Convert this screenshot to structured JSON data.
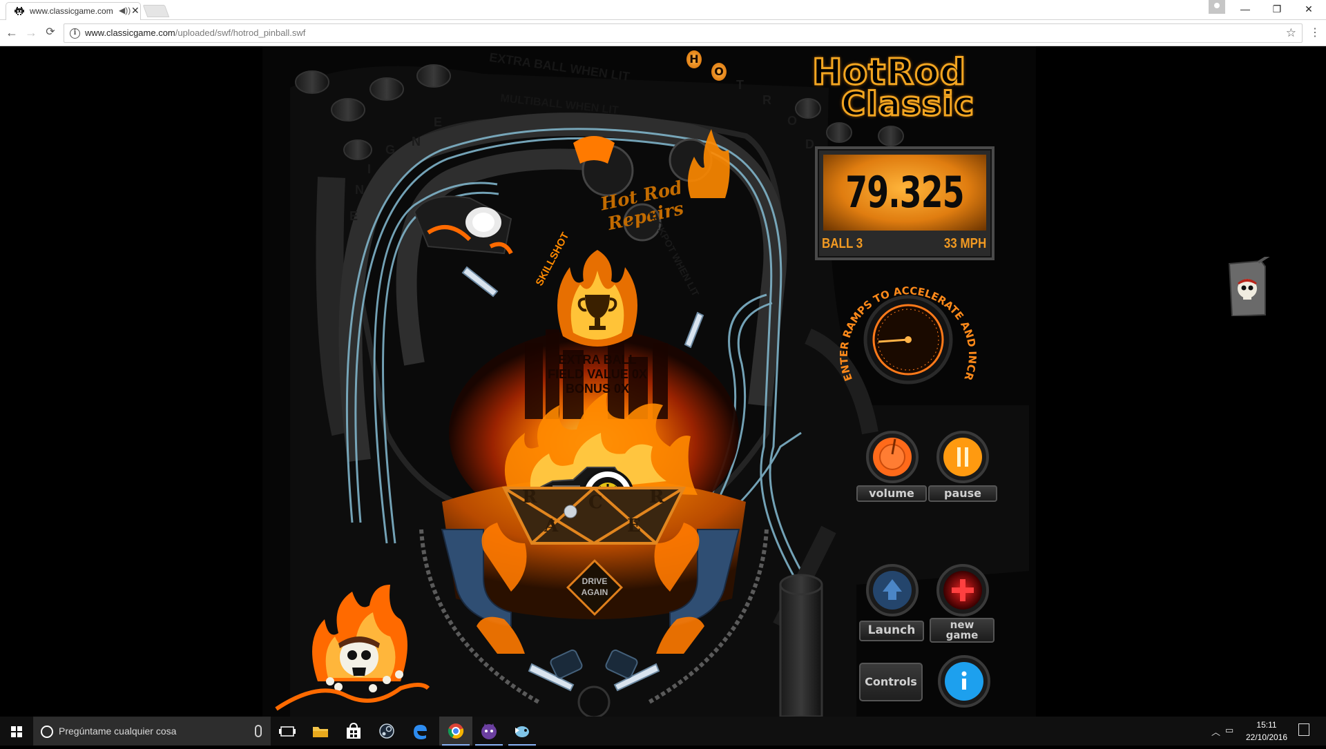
{
  "browser": {
    "tab_title": "www.classicgame.com",
    "tab_audio_icon": "speaker-icon",
    "tab_close": "✕",
    "url_host": "www.classicgame.com",
    "url_path": "/uploaded/swf/hotrod_pinball.swf",
    "window_controls": {
      "minimize": "—",
      "restore": "❐",
      "close": "✕"
    }
  },
  "game": {
    "logo_line1": "HotRod",
    "logo_line2": "Classic",
    "score": "79.325",
    "ball": "BALL 3",
    "speed": "33 MPH",
    "ramp_instruction": "ENTER RAMPS TO ACCELERATE AND INCREASE FIELD VALUE",
    "buttons": {
      "volume": "volume",
      "pause": "pause",
      "launch": "Launch",
      "new_game_line1": "new",
      "new_game_line2": "game",
      "controls": "Controls"
    },
    "table": {
      "extra_ball_when_lit": "EXTRA BALL WHEN LIT",
      "multiball_when_lit": "MULTIBALL WHEN LIT",
      "hot_rod_letters": [
        "H",
        "O",
        "T",
        "R",
        "O",
        "D"
      ],
      "engine_letters": [
        "E",
        "N",
        "G",
        "I",
        "N",
        "E"
      ],
      "skillshot": "SKILLSHOT",
      "repairs_sign": "Hot Rod Repairs",
      "jackpot_when_lit": "JACKPOT WHEN LIT",
      "extra_ball": "EXTRA BALL",
      "field_value": "FIELD VALUE 0X",
      "bonus": "BONUS 0X",
      "racer_letters": [
        "R",
        "A",
        "C",
        "E",
        "R"
      ],
      "drive_again_line1": "DRIVE",
      "drive_again_line2": "AGAIN"
    },
    "accent_colors": {
      "orange": "#f2a521",
      "flame": "#ff6a00",
      "rail": "#7fb3c9"
    }
  },
  "taskbar": {
    "search_placeholder": "Pregúntame cualquier cosa",
    "time": "15:11",
    "date": "22/10/2016",
    "apps": [
      "task-view-icon",
      "file-explorer-icon",
      "store-icon",
      "steam-icon",
      "edge-icon",
      "chrome-icon",
      "app-cat-icon",
      "app-bird-icon"
    ]
  }
}
